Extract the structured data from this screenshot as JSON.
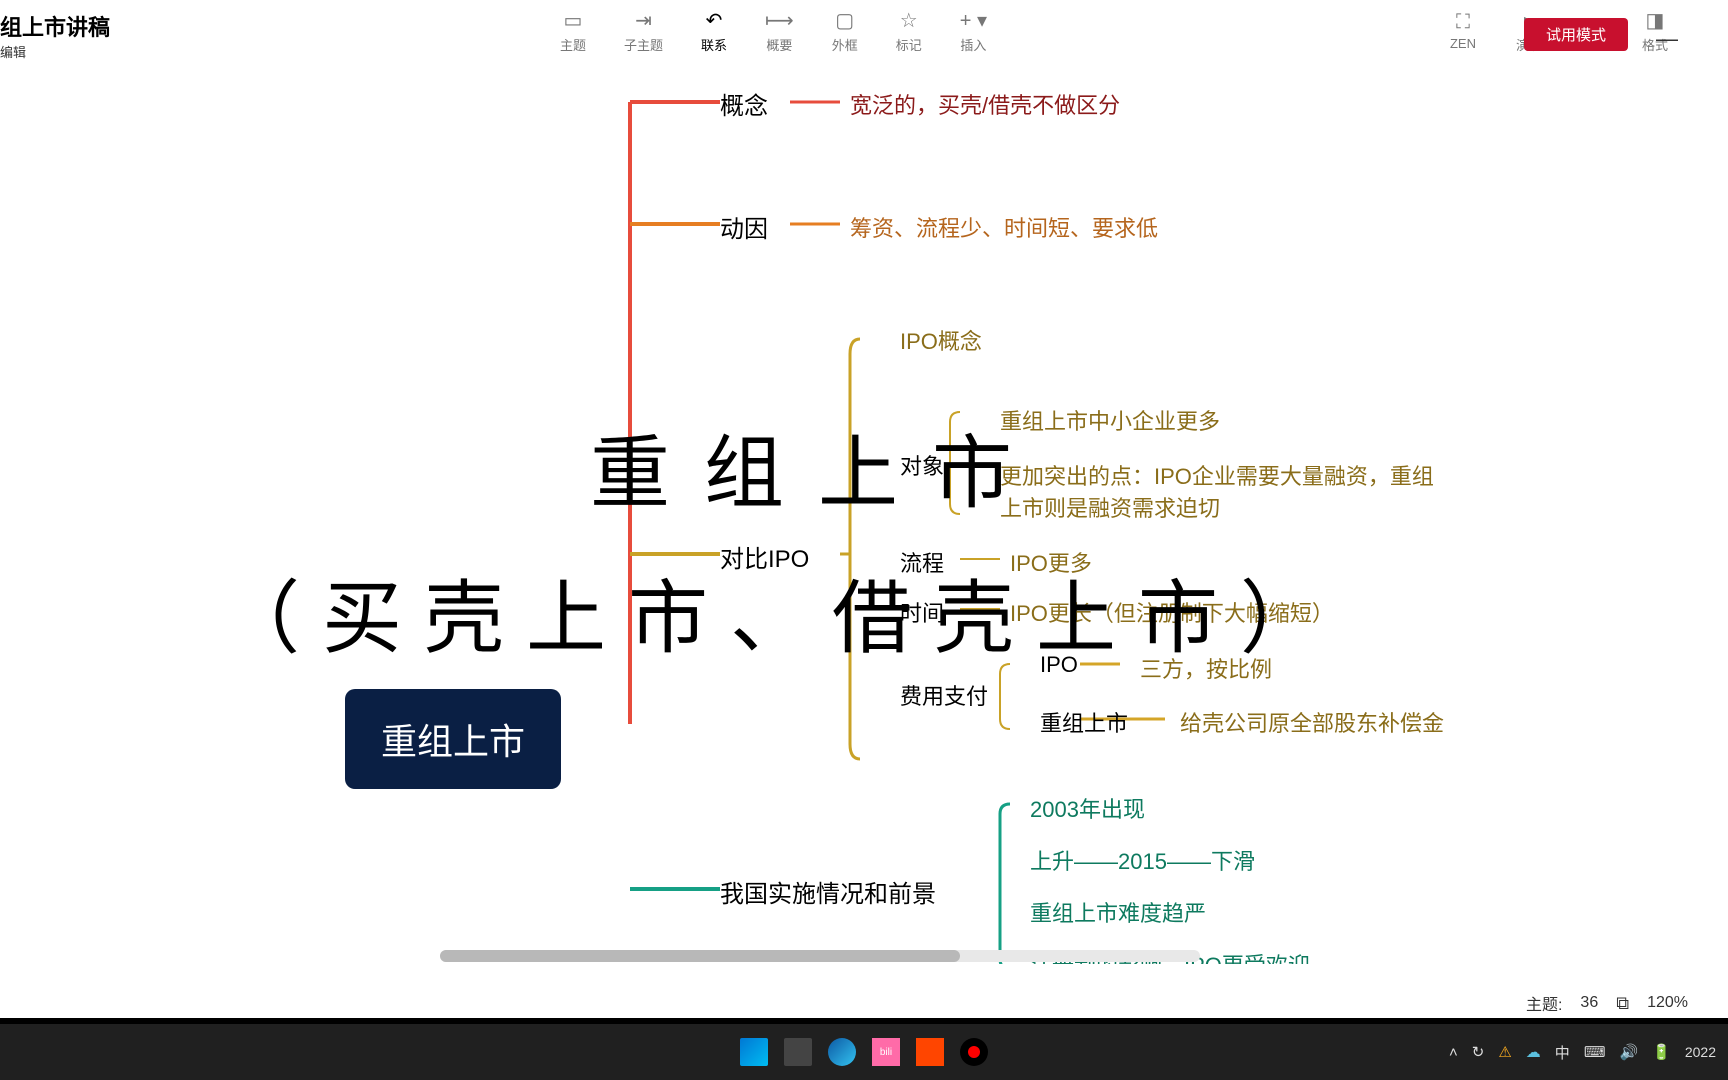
{
  "document": {
    "title": "组上市讲稿",
    "subtitle": "编辑"
  },
  "toolbar": {
    "topic": "主题",
    "subtopic": "子主题",
    "relation": "联系",
    "summary": "概要",
    "boundary": "外框",
    "marker": "标记",
    "insert": "插入",
    "zen": "ZEN",
    "present": "演说",
    "format": "格式",
    "trial": "试用模式"
  },
  "mindmap": {
    "root": "重组上市",
    "b1": {
      "label": "概念",
      "detail": "宽泛的，买壳/借壳不做区分"
    },
    "b2": {
      "label": "动因",
      "detail": "筹资、流程少、时间短、要求低"
    },
    "b3": {
      "label": "对比IPO",
      "c1": "IPO概念",
      "c2": {
        "label": "对象",
        "d1": "重组上市中小企业更多",
        "d2": "更加突出的点：IPO企业需要大量融资，重组上市则是融资需求迫切"
      },
      "c3": {
        "label": "流程",
        "d": "IPO更多"
      },
      "c4": {
        "label": "时间",
        "d": "IPO更长（但注册制下大幅缩短）"
      },
      "c5": {
        "label": "费用支付",
        "d1": {
          "label": "IPO",
          "val": "三方，按比例"
        },
        "d2": {
          "label": "重组上市",
          "val": "给壳公司原全部股东补偿金"
        }
      }
    },
    "b4": {
      "label": "我国实施情况和前景",
      "c1": "2003年出现",
      "c2": "上升——2015——下滑",
      "c3": "重组上市难度趋严",
      "c4": "注册制的影响，IPO更受欢迎"
    }
  },
  "overlay": {
    "line1": "重组上市",
    "line2": "（买壳上市、借壳上市）"
  },
  "statusbar": {
    "topic_count_label": "主题:",
    "topic_count": "36",
    "zoom": "120%"
  },
  "taskbar": {
    "pink": "bili",
    "ime": "中",
    "year": "2022"
  }
}
